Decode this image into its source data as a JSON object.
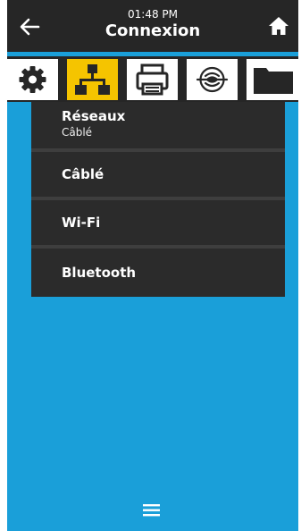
{
  "header": {
    "time": "01:48 PM",
    "title": "Connexion"
  },
  "tabs": [
    {
      "icon": "gear-icon",
      "active": false
    },
    {
      "icon": "network-icon",
      "active": true
    },
    {
      "icon": "printer-icon",
      "active": false
    },
    {
      "icon": "rfid-icon",
      "active": false
    },
    {
      "icon": "folder-icon",
      "active": false
    }
  ],
  "menu": {
    "heading": "Réseaux",
    "heading_sub": "Câblé",
    "items": [
      {
        "label": "Câblé"
      },
      {
        "label": "Wi-Fi"
      },
      {
        "label": "Bluetooth"
      }
    ]
  },
  "colors": {
    "background": "#1a9fd9",
    "header": "#262626",
    "active_tab": "#f5c400",
    "menu": "#2b2b2b"
  }
}
